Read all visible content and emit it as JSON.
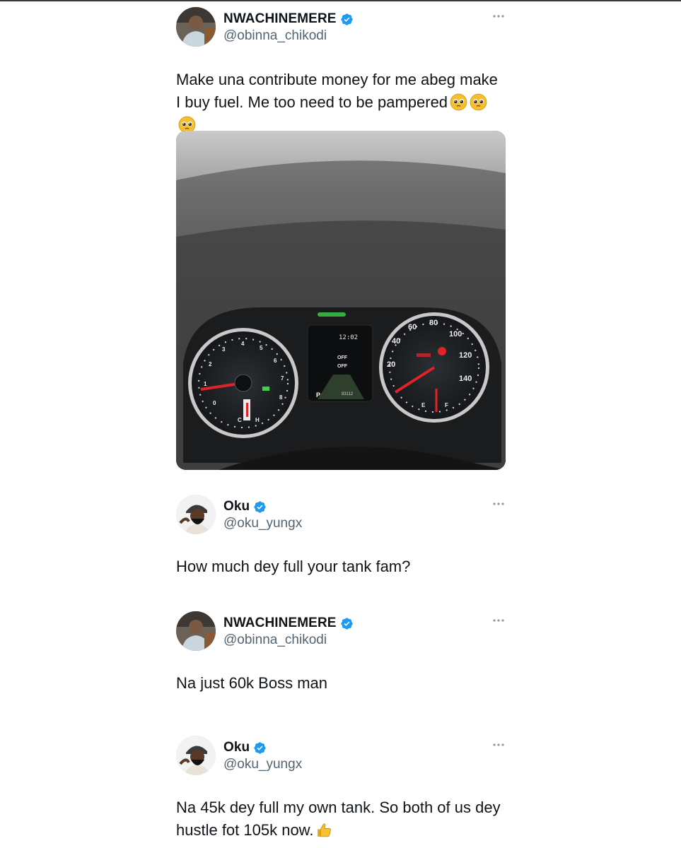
{
  "tweets": [
    {
      "author": "NWACHINEMERE",
      "handle": "@obinna_chikodi",
      "text": "Make una contribute money for me abeg make I buy fuel. Me too need to be pampered",
      "emojis": [
        "pleading-face",
        "pleading-face",
        "pleading-face"
      ],
      "has_media": true
    },
    {
      "author": "Oku",
      "handle": "@oku_yungx",
      "text": "How much dey full your tank fam?"
    },
    {
      "author": "NWACHINEMERE",
      "handle": "@obinna_chikodi",
      "text": "Na just 60k Boss man"
    },
    {
      "author": "Oku",
      "handle": "@oku_yungx",
      "text": "Na 45k dey full my own tank. So both of us dey hustle fot 105k now.",
      "emojis": [
        "thumbs-up"
      ]
    }
  ],
  "media": {
    "clock": "12:02",
    "odometer": "83112",
    "gear": "P",
    "status_lines": [
      "OFF",
      "OFF"
    ],
    "tach_labels": [
      "0",
      "1",
      "2",
      "3",
      "4",
      "5",
      "6",
      "7",
      "8"
    ],
    "speed_labels": [
      "20",
      "40",
      "60",
      "80",
      "100",
      "120",
      "140"
    ],
    "fuel_labels": [
      "E",
      "F"
    ],
    "temp_labels": [
      "C",
      "H"
    ]
  },
  "colors": {
    "verified": "#1d9bf0",
    "handle": "#536471",
    "text": "#0f1419"
  }
}
